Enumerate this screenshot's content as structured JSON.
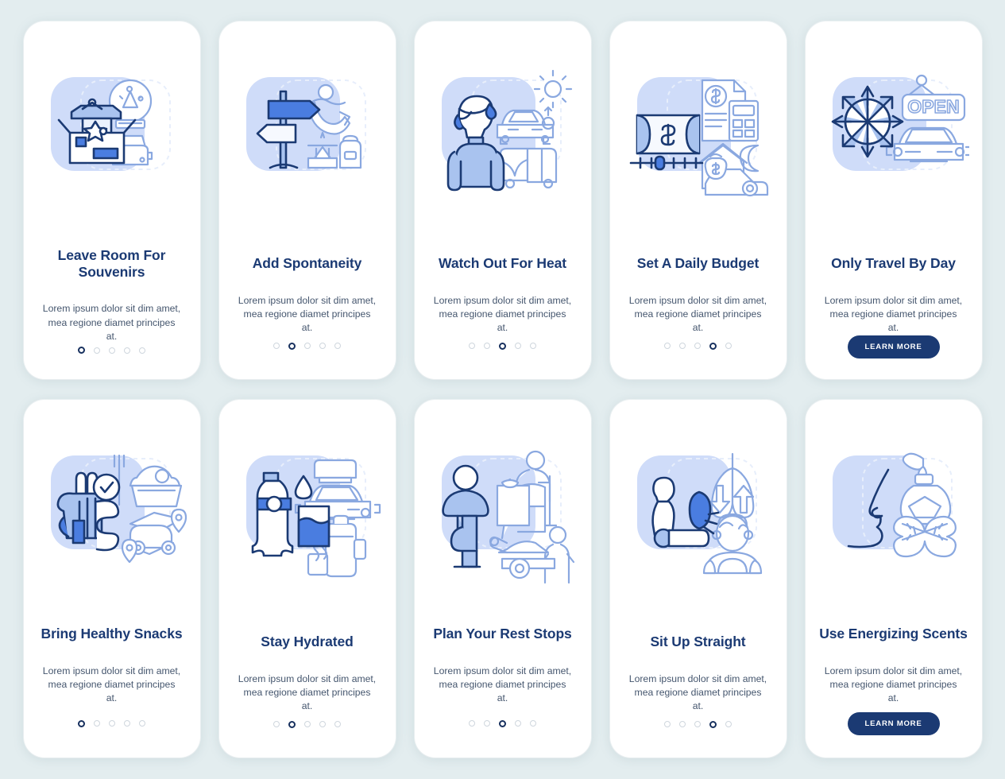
{
  "theme": {
    "page_background": "#e3edef",
    "card_background": "#ffffff",
    "title_color": "#1b3a73",
    "body_text_color": "#45566e",
    "accent_color": "#4a7de0",
    "button_color": "#1b3a73",
    "dot_active_color": "#17305e",
    "dot_inactive_color": "#cfd6dd",
    "illustration_panel_color": "#cfdcf9"
  },
  "common": {
    "description": "Lorem ipsum dolor sit dim amet, mea regione diamet principes at.",
    "learn_more_label": "LEARN MORE",
    "dot_count": 5
  },
  "rows": [
    {
      "cards": [
        {
          "title": "Leave Room For Souvenirs",
          "description": "Lorem ipsum dolor sit dim amet, mea regione diamet principes at.",
          "icon": "souvenir-box-icon",
          "active_dot": 0,
          "footer": "dots",
          "button_label": null
        },
        {
          "title": "Add Spontaneity",
          "description": "Lorem ipsum dolor sit dim amet, mea regione diamet principes at.",
          "icon": "signpost-icon",
          "active_dot": 1,
          "footer": "dots",
          "button_label": null
        },
        {
          "title": "Watch Out For Heat",
          "description": "Lorem ipsum dolor sit dim amet, mea regione diamet principes at.",
          "icon": "sweating-person-icon",
          "active_dot": 2,
          "footer": "dots",
          "button_label": null
        },
        {
          "title": "Set A Daily Budget",
          "description": "Lorem ipsum dolor sit dim amet, mea regione diamet principes at.",
          "icon": "money-budget-icon",
          "active_dot": 3,
          "footer": "dots",
          "button_label": null
        },
        {
          "title": "Only Travel By Day",
          "description": "Lorem ipsum dolor sit dim amet, mea regione diamet principes at.",
          "icon": "sun-clock-open-icon",
          "active_dot": 4,
          "footer": "button",
          "button_label": "LEARN MORE"
        }
      ]
    },
    {
      "cards": [
        {
          "title": "Bring Healthy Snacks",
          "description": "Lorem ipsum dolor sit dim amet, mea regione diamet principes at.",
          "icon": "healthy-food-icon",
          "active_dot": 0,
          "footer": "dots",
          "button_label": null
        },
        {
          "title": "Stay Hydrated",
          "description": "Lorem ipsum dolor sit dim amet, mea regione diamet principes at.",
          "icon": "water-bottle-icon",
          "active_dot": 1,
          "footer": "dots",
          "button_label": null
        },
        {
          "title": "Plan Your Rest Stops",
          "description": "Lorem ipsum dolor sit dim amet, mea regione diamet principes at.",
          "icon": "stretching-person-icon",
          "active_dot": 2,
          "footer": "dots",
          "button_label": null
        },
        {
          "title": "Sit Up Straight",
          "description": "Lorem ipsum dolor sit dim amet, mea regione diamet principes at.",
          "icon": "posture-lungs-icon",
          "active_dot": 3,
          "footer": "dots",
          "button_label": null
        },
        {
          "title": "Use Energizing Scents",
          "description": "Lorem ipsum dolor sit dim amet, mea regione diamet principes at.",
          "icon": "aroma-scent-icon",
          "active_dot": 4,
          "footer": "button",
          "button_label": "LEARN MORE"
        }
      ]
    }
  ]
}
